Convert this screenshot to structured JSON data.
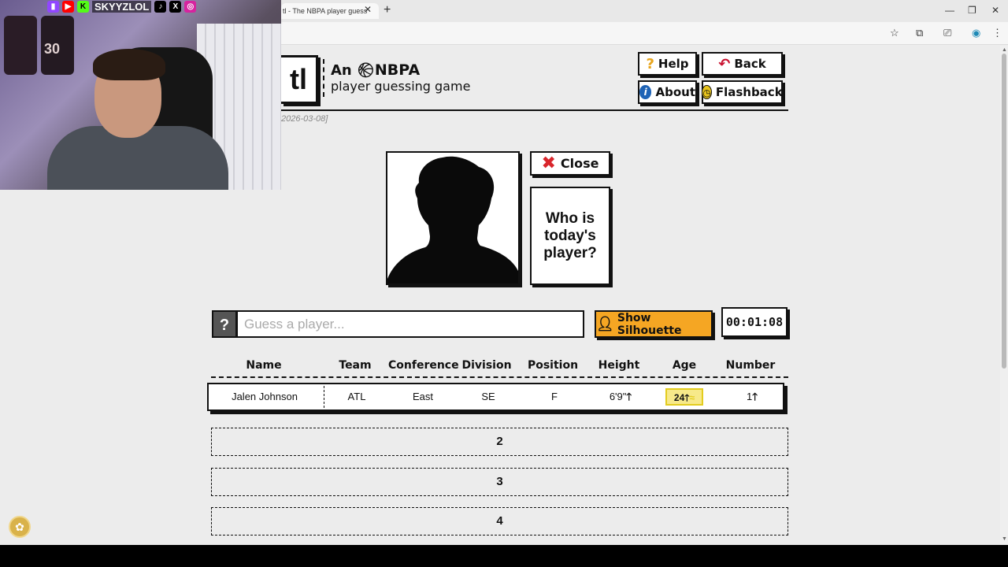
{
  "browser": {
    "tab_title": "tl - The NBPA player guess",
    "tab_close": "✕",
    "new_tab": "+",
    "window_minimize": "—",
    "window_restore": "❐",
    "window_close": "✕"
  },
  "stream": {
    "handle": "SKYYZLOL",
    "jersey_number": "30"
  },
  "header": {
    "logo_fragment": "tl",
    "tagline_prefix": "An",
    "tagline_brand": "NBPA",
    "tagline_line2": "player guessing game",
    "date_fragment": "2026-03-08]"
  },
  "buttons": {
    "help": "Help",
    "back": "Back",
    "about": "About",
    "flashback": "Flashback",
    "close": "Close",
    "show_silhouette": "Show Silhouette"
  },
  "card": {
    "prompt": "Who is today's player?"
  },
  "guess": {
    "placeholder": "Guess a player...",
    "help_glyph": "?",
    "timer": "00:01:08"
  },
  "table": {
    "headers": [
      "Name",
      "Team",
      "Conference",
      "Division",
      "Position",
      "Height",
      "Age",
      "Number"
    ],
    "guesses": [
      {
        "name": "Jalen Johnson",
        "team": "ATL",
        "conference": "East",
        "division": "SE",
        "position": "F",
        "height": "6'9\"",
        "age": "24",
        "number": "1"
      }
    ],
    "empty_rows": [
      "2",
      "3",
      "4"
    ]
  },
  "colors": {
    "accent": "#f5a623",
    "age_highlight": "#f7e98a",
    "close_x": "#d9262c",
    "back_arrow": "#c8102e",
    "about_icon": "#1e63b6",
    "flashback_icon": "#e8c41c"
  }
}
